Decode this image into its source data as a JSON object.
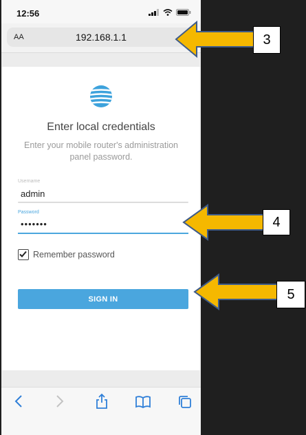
{
  "status_bar": {
    "time": "12:56"
  },
  "browser": {
    "text_size_label": "AA",
    "url": "192.168.1.1"
  },
  "form": {
    "title": "Enter local credentials",
    "subtitle": "Enter your mobile router's administration panel password.",
    "username_label": "Username",
    "username_value": "admin",
    "password_label": "Password",
    "password_value": "•••••••",
    "remember_label": "Remember password",
    "remember_checked": true,
    "signin_label": "SIGN IN"
  },
  "callouts": [
    "3",
    "4",
    "5"
  ],
  "colors": {
    "accent": "#4aa6de",
    "arrow": "#f5b800",
    "arrow_outline": "#3f5c8a"
  }
}
